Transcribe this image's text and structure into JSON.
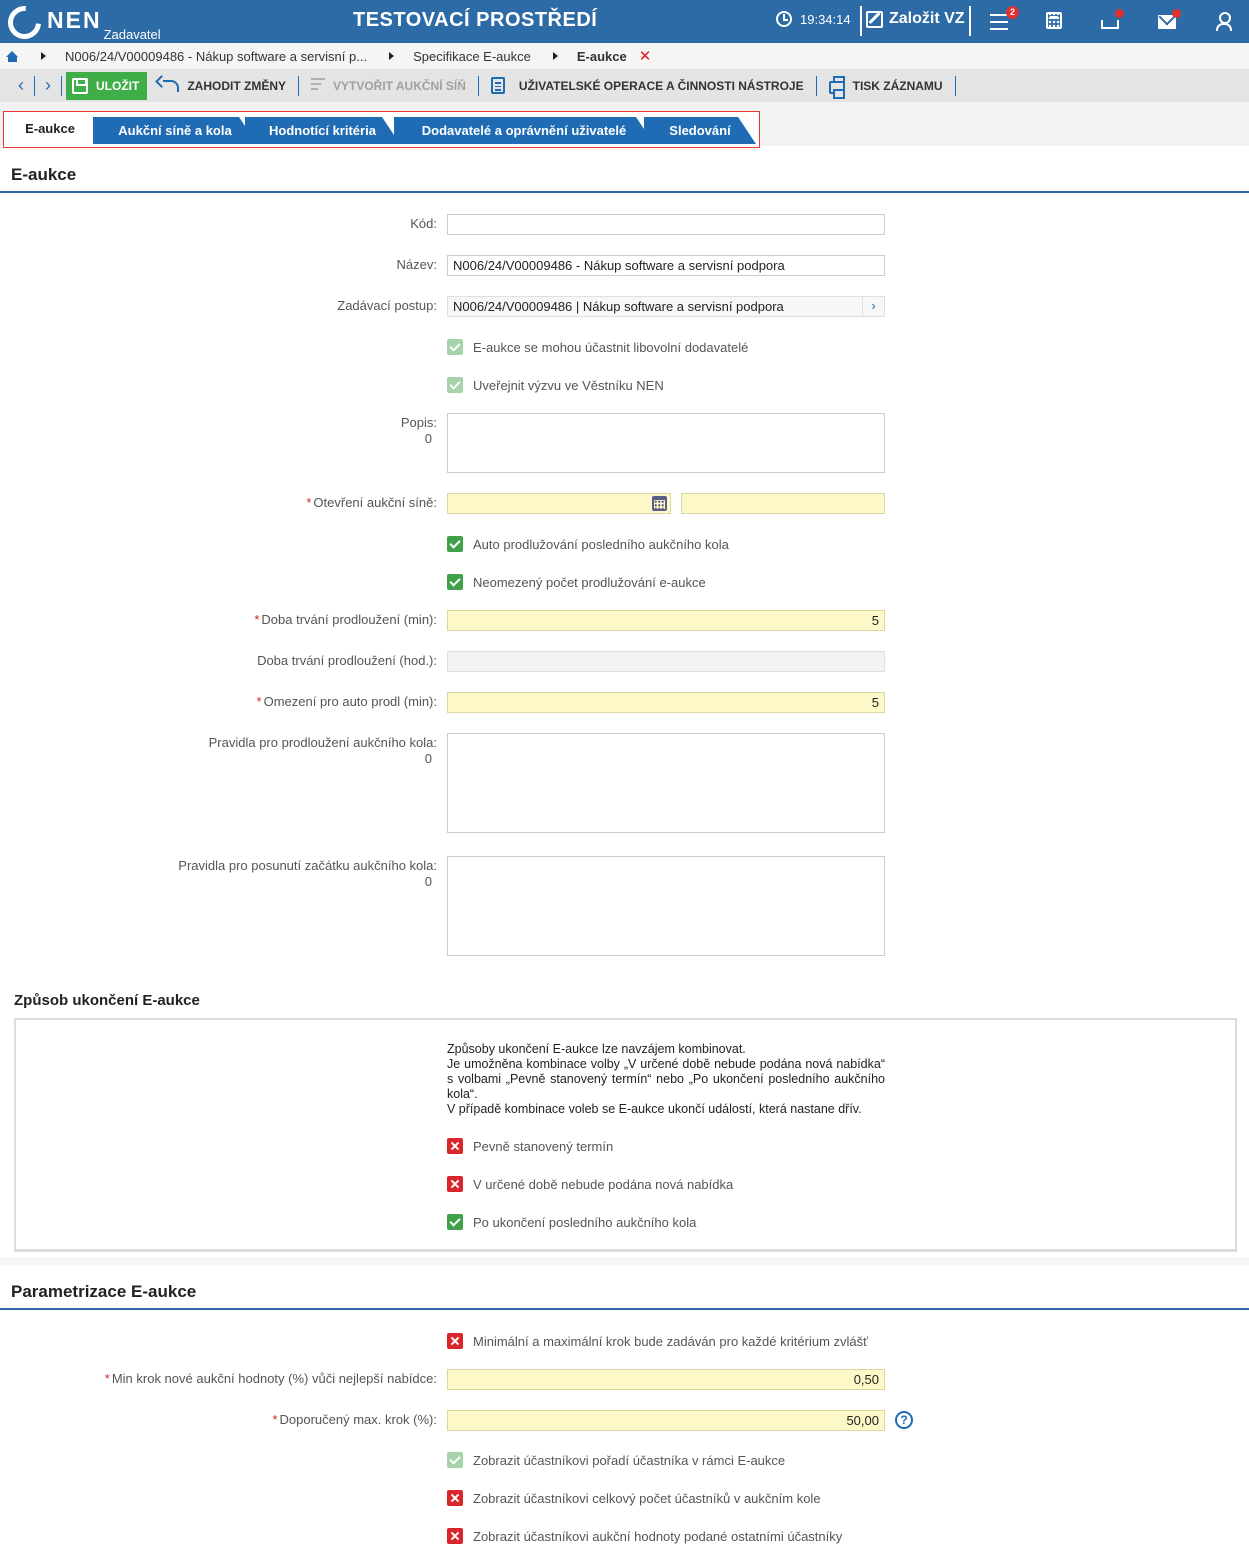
{
  "topbar": {
    "logo_text": "NEN",
    "logo_role": "Zadavatel",
    "environment_title": "TESTOVACÍ PROSTŘEDÍ",
    "clock": "19:34:14",
    "create_button": "Založit VZ",
    "menu_badge": "2",
    "icons": [
      "menu-icon",
      "calculator-icon",
      "inbox-icon",
      "mail-icon",
      "user-icon"
    ]
  },
  "breadcrumb": {
    "items": [
      "N006/24/V00009486 - Nákup software a servisní p...",
      "Specifikace E-aukce",
      "E-aukce"
    ],
    "close": "✕"
  },
  "toolbar": {
    "save": "ULOŽIT",
    "discard": "ZAHODIT ZMĚNY",
    "create_room": "VYTVOŘIT AUKČNÍ SÍŇ",
    "user_ops": "UŽIVATELSKÉ OPERACE A ČINNOSTI NÁSTROJE",
    "print": "TISK ZÁZNAMU"
  },
  "tabs": [
    {
      "label": "E-aukce",
      "active": true
    },
    {
      "label": "Aukční síně a kola",
      "active": false
    },
    {
      "label": "Hodnotící kritéria",
      "active": false
    },
    {
      "label": "Dodavatelé a oprávnění uživatelé",
      "active": false
    },
    {
      "label": "Sledování",
      "active": false
    }
  ],
  "section_eaukce": {
    "title": "E-aukce",
    "kod_label": "Kód:",
    "kod_value": "",
    "nazev_label": "Název:",
    "nazev_value": "N006/24/V00009486 - Nákup software a servisní podpora",
    "postup_label": "Zadávací postup:",
    "postup_value": "N006/24/V00009486 | Nákup software a servisní podpora",
    "cb_any_suppliers": "E-aukce se mohou účastnit libovolní dodavatelé",
    "cb_publish": "Uveřejnit výzvu ve Věstníku NEN",
    "popis_label": "Popis:",
    "popis_count": "0",
    "otevreni_label": "Otevření aukční síně:",
    "otevreni_date": "",
    "otevreni_time": "",
    "cb_auto_extend": "Auto prodlužování posledního aukčního kola",
    "cb_unlimited": "Neomezený počet prodlužování e-aukce",
    "doba_min_label": "Doba trvání prodloužení (min):",
    "doba_min_value": "5",
    "doba_hod_label": "Doba trvání prodloužení (hod.):",
    "doba_hod_value": "",
    "omezeni_label": "Omezení pro auto prodl (min):",
    "omezeni_value": "5",
    "pravidla_prodl_label": "Pravidla pro prodloužení aukčního kola:",
    "pravidla_prodl_count": "0",
    "pravidla_posun_label": "Pravidla pro posunutí začátku aukčního kola:",
    "pravidla_posun_count": "0"
  },
  "section_end": {
    "title": "Způsob ukončení E-aukce",
    "info_line1": "Způsoby ukončení E-aukce lze navzájem kombinovat.",
    "info_line2": "Je umožněna kombinace volby „V určené době nebude podána nová nabídka“ s volbami „Pevně stanovený termín“ nebo „Po ukončení posledního aukčního kola“.",
    "info_line3": "V případě kombinace voleb se E-aukce ukončí událostí, která nastane dřív.",
    "cb_fixed": "Pevně stanovený termín",
    "cb_no_offer": "V určené době nebude podána nová nabídka",
    "cb_after_round": "Po ukončení posledního aukčního kola"
  },
  "section_param": {
    "title": "Parametrizace E-aukce",
    "cb_min_max_step": "Minimální a maximální krok bude zadáván pro každé kritérium zvlášť",
    "min_step_label": "Min krok nové aukční hodnoty (%) vůči nejlepší nabídce:",
    "min_step_value": "0,50",
    "max_step_label": "Doporučený max. krok (%):",
    "max_step_value": "50,00",
    "help": "?",
    "cb_show_rank": "Zobrazit účastníkovi pořadí účastníka v rámci E-aukce",
    "cb_show_count": "Zobrazit účastníkovi celkový počet účastníků v aukčním kole",
    "cb_show_values": "Zobrazit účastníkovi aukční hodnoty podané ostatními účastníky"
  },
  "colors": {
    "brand_blue": "#2d6ba6",
    "tab_blue": "#1f6cb5",
    "save_green": "#3fae49",
    "check_green": "#3fa14a",
    "cross_red": "#d9262b",
    "required_yellow": "#fdf8c8"
  }
}
